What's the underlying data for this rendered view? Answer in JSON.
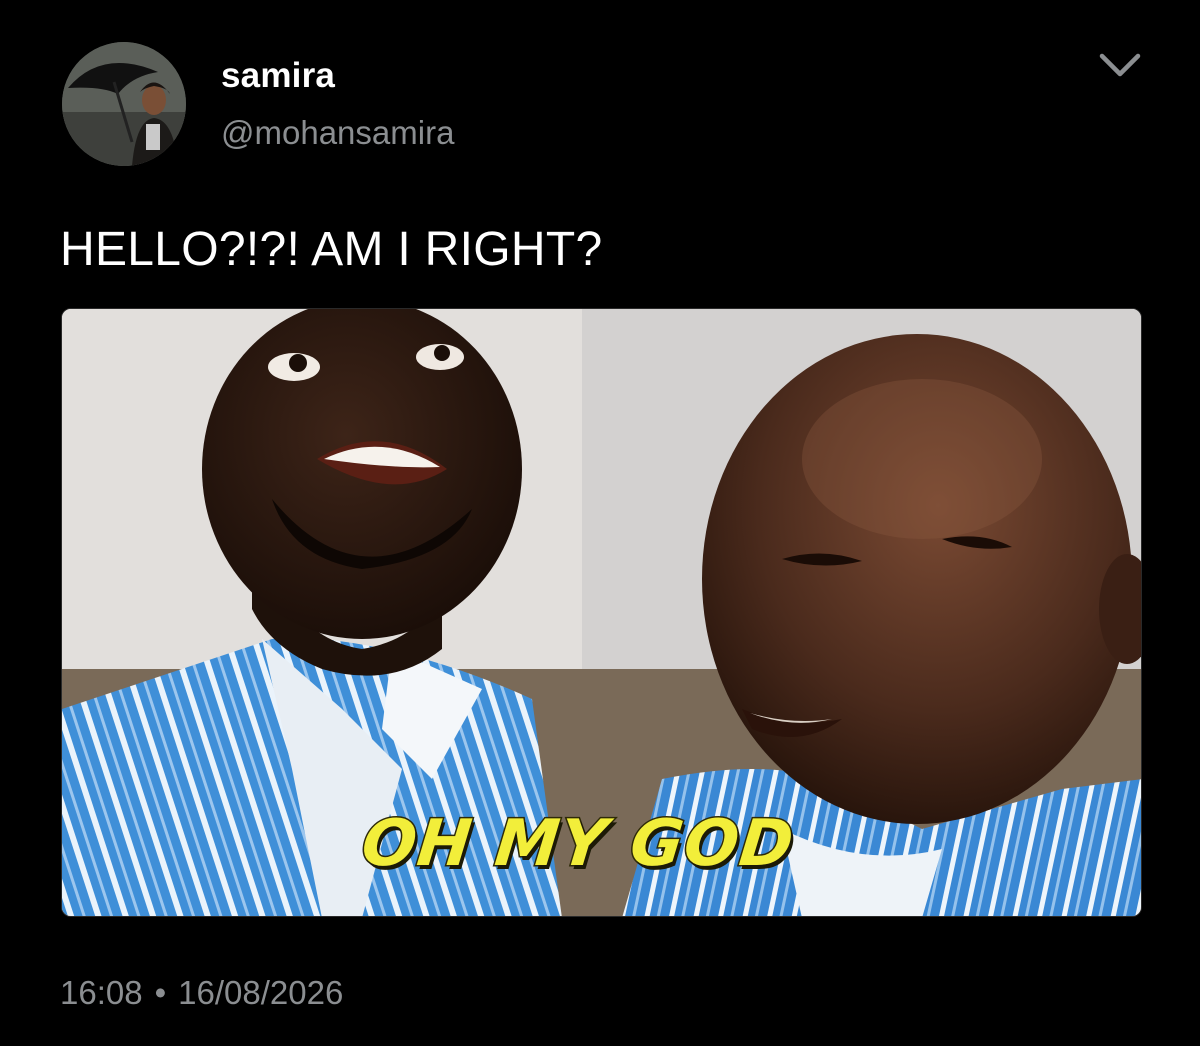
{
  "author": {
    "display_name": "samira",
    "handle": "@mohansamira"
  },
  "icons": {
    "menu": "chevron-down-icon"
  },
  "tweet": {
    "text": "HELLO?!?! AM I RIGHT?",
    "media_caption": "OH MY GOD",
    "time": "16:08",
    "separator": "•",
    "date": "16/08/2026"
  },
  "colors": {
    "background": "#000000",
    "primary_text": "#ffffff",
    "secondary_text": "#8b8e91",
    "caption_fill": "#f2ee3a",
    "shirt_blue": "#3f8fd8"
  }
}
